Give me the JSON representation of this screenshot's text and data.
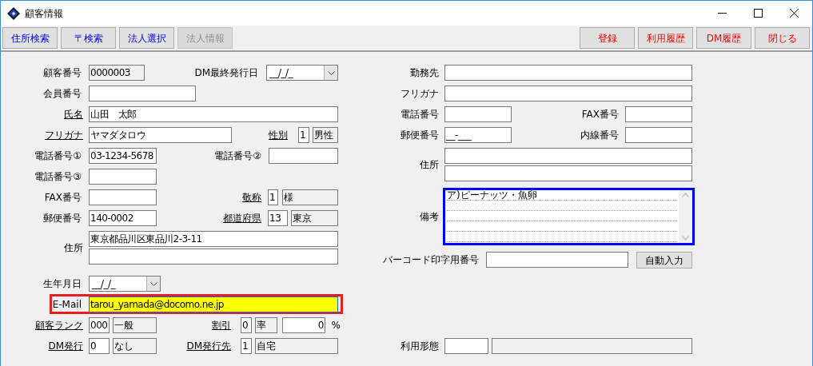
{
  "window": {
    "title": "顧客情報"
  },
  "toolbar_left": [
    {
      "label": "住所検索",
      "disabled": false
    },
    {
      "label": "〒検索",
      "disabled": false
    },
    {
      "label": "法人選択",
      "disabled": false
    },
    {
      "label": "法人情報",
      "disabled": true
    }
  ],
  "toolbar_right": [
    {
      "label": "登録"
    },
    {
      "label": "利用履歴"
    },
    {
      "label": "DM履歴"
    },
    {
      "label": "閉じる"
    }
  ],
  "left_form": [
    {
      "items": [
        {
          "kind": "label",
          "text": "顧客番号",
          "underlined": false
        },
        {
          "kind": "readonly",
          "value": "0000003"
        },
        {
          "kind": "label",
          "text": "DM最終発行日",
          "underlined": false
        },
        {
          "kind": "date",
          "value": "__/_/_"
        }
      ]
    },
    {
      "items": [
        {
          "kind": "label",
          "text": "会員番号",
          "underlined": false
        },
        {
          "kind": "field"
        }
      ]
    },
    {
      "items": [
        {
          "kind": "label",
          "text": "氏名",
          "underlined": true
        },
        {
          "kind": "field",
          "value": "山田　太郎"
        }
      ]
    },
    {
      "items": [
        {
          "kind": "label",
          "text": "フリガナ",
          "underlined": true
        },
        {
          "kind": "field",
          "value": "ヤマダタロウ"
        },
        {
          "kind": "label",
          "text": "性別",
          "underlined": true
        },
        {
          "kind": "code",
          "value": "1"
        },
        {
          "kind": "readonly",
          "value": "男性"
        }
      ]
    },
    {
      "items": [
        {
          "kind": "label",
          "text": "電話番号①",
          "underlined": false
        },
        {
          "kind": "field",
          "value": "03-1234-5678"
        },
        {
          "kind": "label",
          "text": "電話番号②",
          "underlined": false
        },
        {
          "kind": "field"
        }
      ]
    },
    {
      "items": [
        {
          "kind": "label",
          "text": "電話番号③",
          "underlined": false
        },
        {
          "kind": "field"
        }
      ]
    },
    {
      "items": [
        {
          "kind": "label",
          "text": "FAX番号",
          "underlined": false
        },
        {
          "kind": "field"
        },
        {
          "kind": "label",
          "text": "敬称",
          "underlined": true
        },
        {
          "kind": "code",
          "value": "1"
        },
        {
          "kind": "readonly",
          "value": "様"
        }
      ]
    },
    {
      "items": [
        {
          "kind": "label",
          "text": "郵便番号",
          "underlined": false
        },
        {
          "kind": "field",
          "value": "140-0002"
        },
        {
          "kind": "label",
          "text": "都道府県",
          "underlined": true
        },
        {
          "kind": "code",
          "value": "13"
        },
        {
          "kind": "readonly",
          "value": "東京"
        }
      ]
    },
    {
      "items": [
        {
          "kind": "label",
          "text": "住所",
          "underlined": false
        },
        {
          "kind": "multi",
          "fields": [
            {
              "kind": "field",
              "value": "東京都品川区東品川2-3-11"
            },
            {
              "kind": "field"
            }
          ]
        }
      ]
    },
    {
      "items": [
        {
          "kind": "label",
          "text": "生年月日",
          "underlined": false
        },
        {
          "kind": "date",
          "value": "__/_/_"
        }
      ]
    },
    {
      "highlighted": true,
      "items": [
        {
          "kind": "label",
          "text": "E-Mail",
          "underlined": false
        },
        {
          "kind": "field",
          "value": "tarou_yamada@docomo.ne.jp",
          "highlighted": true
        }
      ]
    },
    {
      "items": [
        {
          "kind": "label",
          "text": "顧客ランク",
          "underlined": true
        },
        {
          "kind": "code",
          "value": "000"
        },
        {
          "kind": "readonly",
          "value": "一般"
        },
        {
          "kind": "label",
          "text": "割引",
          "underlined": true
        },
        {
          "kind": "code",
          "value": "0"
        },
        {
          "kind": "readonly",
          "value": "率"
        },
        {
          "kind": "number",
          "value": "0"
        },
        {
          "kind": "unit",
          "text": "%"
        }
      ]
    },
    {
      "items": [
        {
          "kind": "label",
          "text": "DM発行",
          "underlined": true
        },
        {
          "kind": "code",
          "value": "0"
        },
        {
          "kind": "readonly",
          "value": "なし"
        },
        {
          "kind": "label",
          "text": "DM発行先",
          "underlined": true
        },
        {
          "kind": "code",
          "value": "1"
        },
        {
          "kind": "readonly",
          "value": "自宅"
        }
      ]
    }
  ],
  "right_form": [
    {
      "items": [
        {
          "kind": "label",
          "text": "勤務先",
          "underlined": false
        },
        {
          "kind": "field"
        }
      ]
    },
    {
      "items": [
        {
          "kind": "label",
          "text": "フリガナ",
          "underlined": false
        },
        {
          "kind": "field"
        }
      ]
    },
    {
      "items": [
        {
          "kind": "label",
          "text": "電話番号",
          "underlined": false
        },
        {
          "kind": "field"
        },
        {
          "kind": "label",
          "text": "FAX番号",
          "underlined": false
        },
        {
          "kind": "field"
        }
      ]
    },
    {
      "items": [
        {
          "kind": "label",
          "text": "郵便番号",
          "underlined": false
        },
        {
          "kind": "field",
          "value": "__-___"
        },
        {
          "kind": "label",
          "text": "内線番号",
          "underlined": false
        },
        {
          "kind": "field"
        }
      ]
    },
    {
      "items": [
        {
          "kind": "label",
          "text": "住所",
          "underlined": false
        },
        {
          "kind": "multi",
          "fields": [
            {
              "kind": "field"
            },
            {
              "kind": "field"
            }
          ]
        }
      ]
    },
    {
      "items": [
        {
          "kind": "label",
          "text": "備考",
          "underlined": false
        },
        {
          "kind": "memo",
          "focused": true,
          "lines": [
            "ア)ピーナッツ・魚卵"
          ]
        }
      ]
    },
    {
      "items": [
        {
          "kind": "label",
          "text": "バーコード印字用番号",
          "underlined": false
        },
        {
          "kind": "field"
        },
        {
          "kind": "button",
          "label": "自動入力"
        }
      ]
    },
    {
      "items": [
        {
          "kind": "label",
          "text": "利用形態",
          "underlined": false
        },
        {
          "kind": "field"
        },
        {
          "kind": "readonly"
        }
      ]
    }
  ]
}
